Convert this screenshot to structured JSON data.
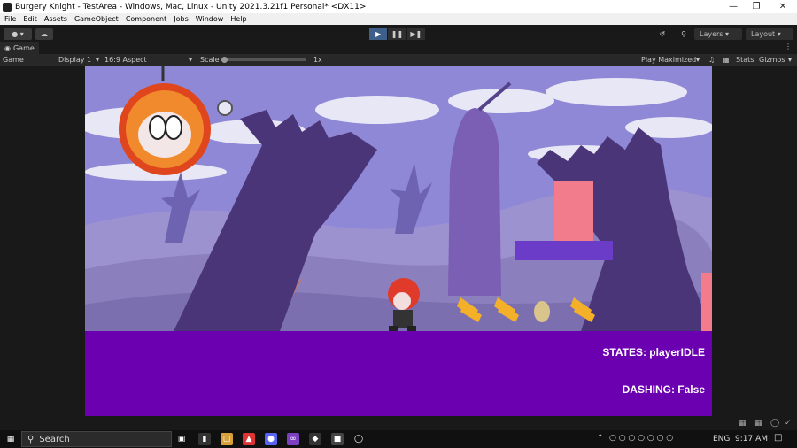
{
  "window": {
    "title": "Burgery Knight - TestArea - Windows, Mac, Linux - Unity 2021.3.21f1 Personal* <DX11>",
    "min_icon": "minimize-icon",
    "max_icon": "maximize-icon",
    "close_icon": "close-icon"
  },
  "menu": [
    "File",
    "Edit",
    "Assets",
    "GameObject",
    "Component",
    "Jobs",
    "Window",
    "Help"
  ],
  "toolbar": {
    "layers_label": "Layers",
    "layout_label": "Layout"
  },
  "game_tab": {
    "label": "Game"
  },
  "game_bar": {
    "mode": "Game",
    "display": "Display 1",
    "aspect": "16:9 Aspect",
    "scale_label": "Scale",
    "scale_value": "1x",
    "play_mode": "Play Maximized",
    "stats": "Stats",
    "gizmos": "Gizmos"
  },
  "hud": {
    "state_text": "STATES: playerIDLE",
    "dash_text": "DASHING: False"
  },
  "colors": {
    "ground": "#6a00b0",
    "sky": "#8f88d6",
    "platform": "#6a3cc8",
    "block": "#f27c8c",
    "play_active": "#3e5f8a"
  },
  "taskbar": {
    "search_placeholder": "Search",
    "lang": "ENG",
    "time": "9:17 AM"
  }
}
